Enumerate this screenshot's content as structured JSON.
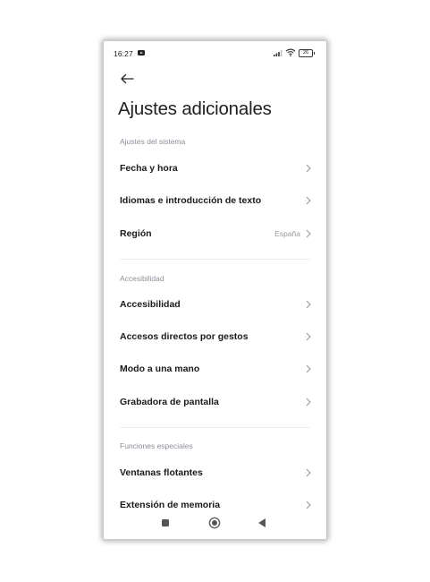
{
  "status_bar": {
    "time": "16:27",
    "battery": "26"
  },
  "header": {
    "title": "Ajustes adicionales"
  },
  "sections": [
    {
      "header": "Ajustes del sistema",
      "items": [
        {
          "label": "Fecha y hora",
          "value": ""
        },
        {
          "label": "Idiomas e introducción de texto",
          "value": ""
        },
        {
          "label": "Región",
          "value": "España"
        }
      ]
    },
    {
      "header": "Accesibilidad",
      "items": [
        {
          "label": "Accesibilidad",
          "value": ""
        },
        {
          "label": "Accesos directos por gestos",
          "value": ""
        },
        {
          "label": "Modo a una mano",
          "value": ""
        },
        {
          "label": "Grabadora de pantalla",
          "value": ""
        }
      ]
    },
    {
      "header": "Funciones especiales",
      "items": [
        {
          "label": "Ventanas flotantes",
          "value": ""
        },
        {
          "label": "Extensión de memoria",
          "value": ""
        }
      ]
    }
  ],
  "colors": {
    "section_header": "#8a8f99",
    "label": "#1a1a1a",
    "chevron": "#9a9a9a"
  }
}
